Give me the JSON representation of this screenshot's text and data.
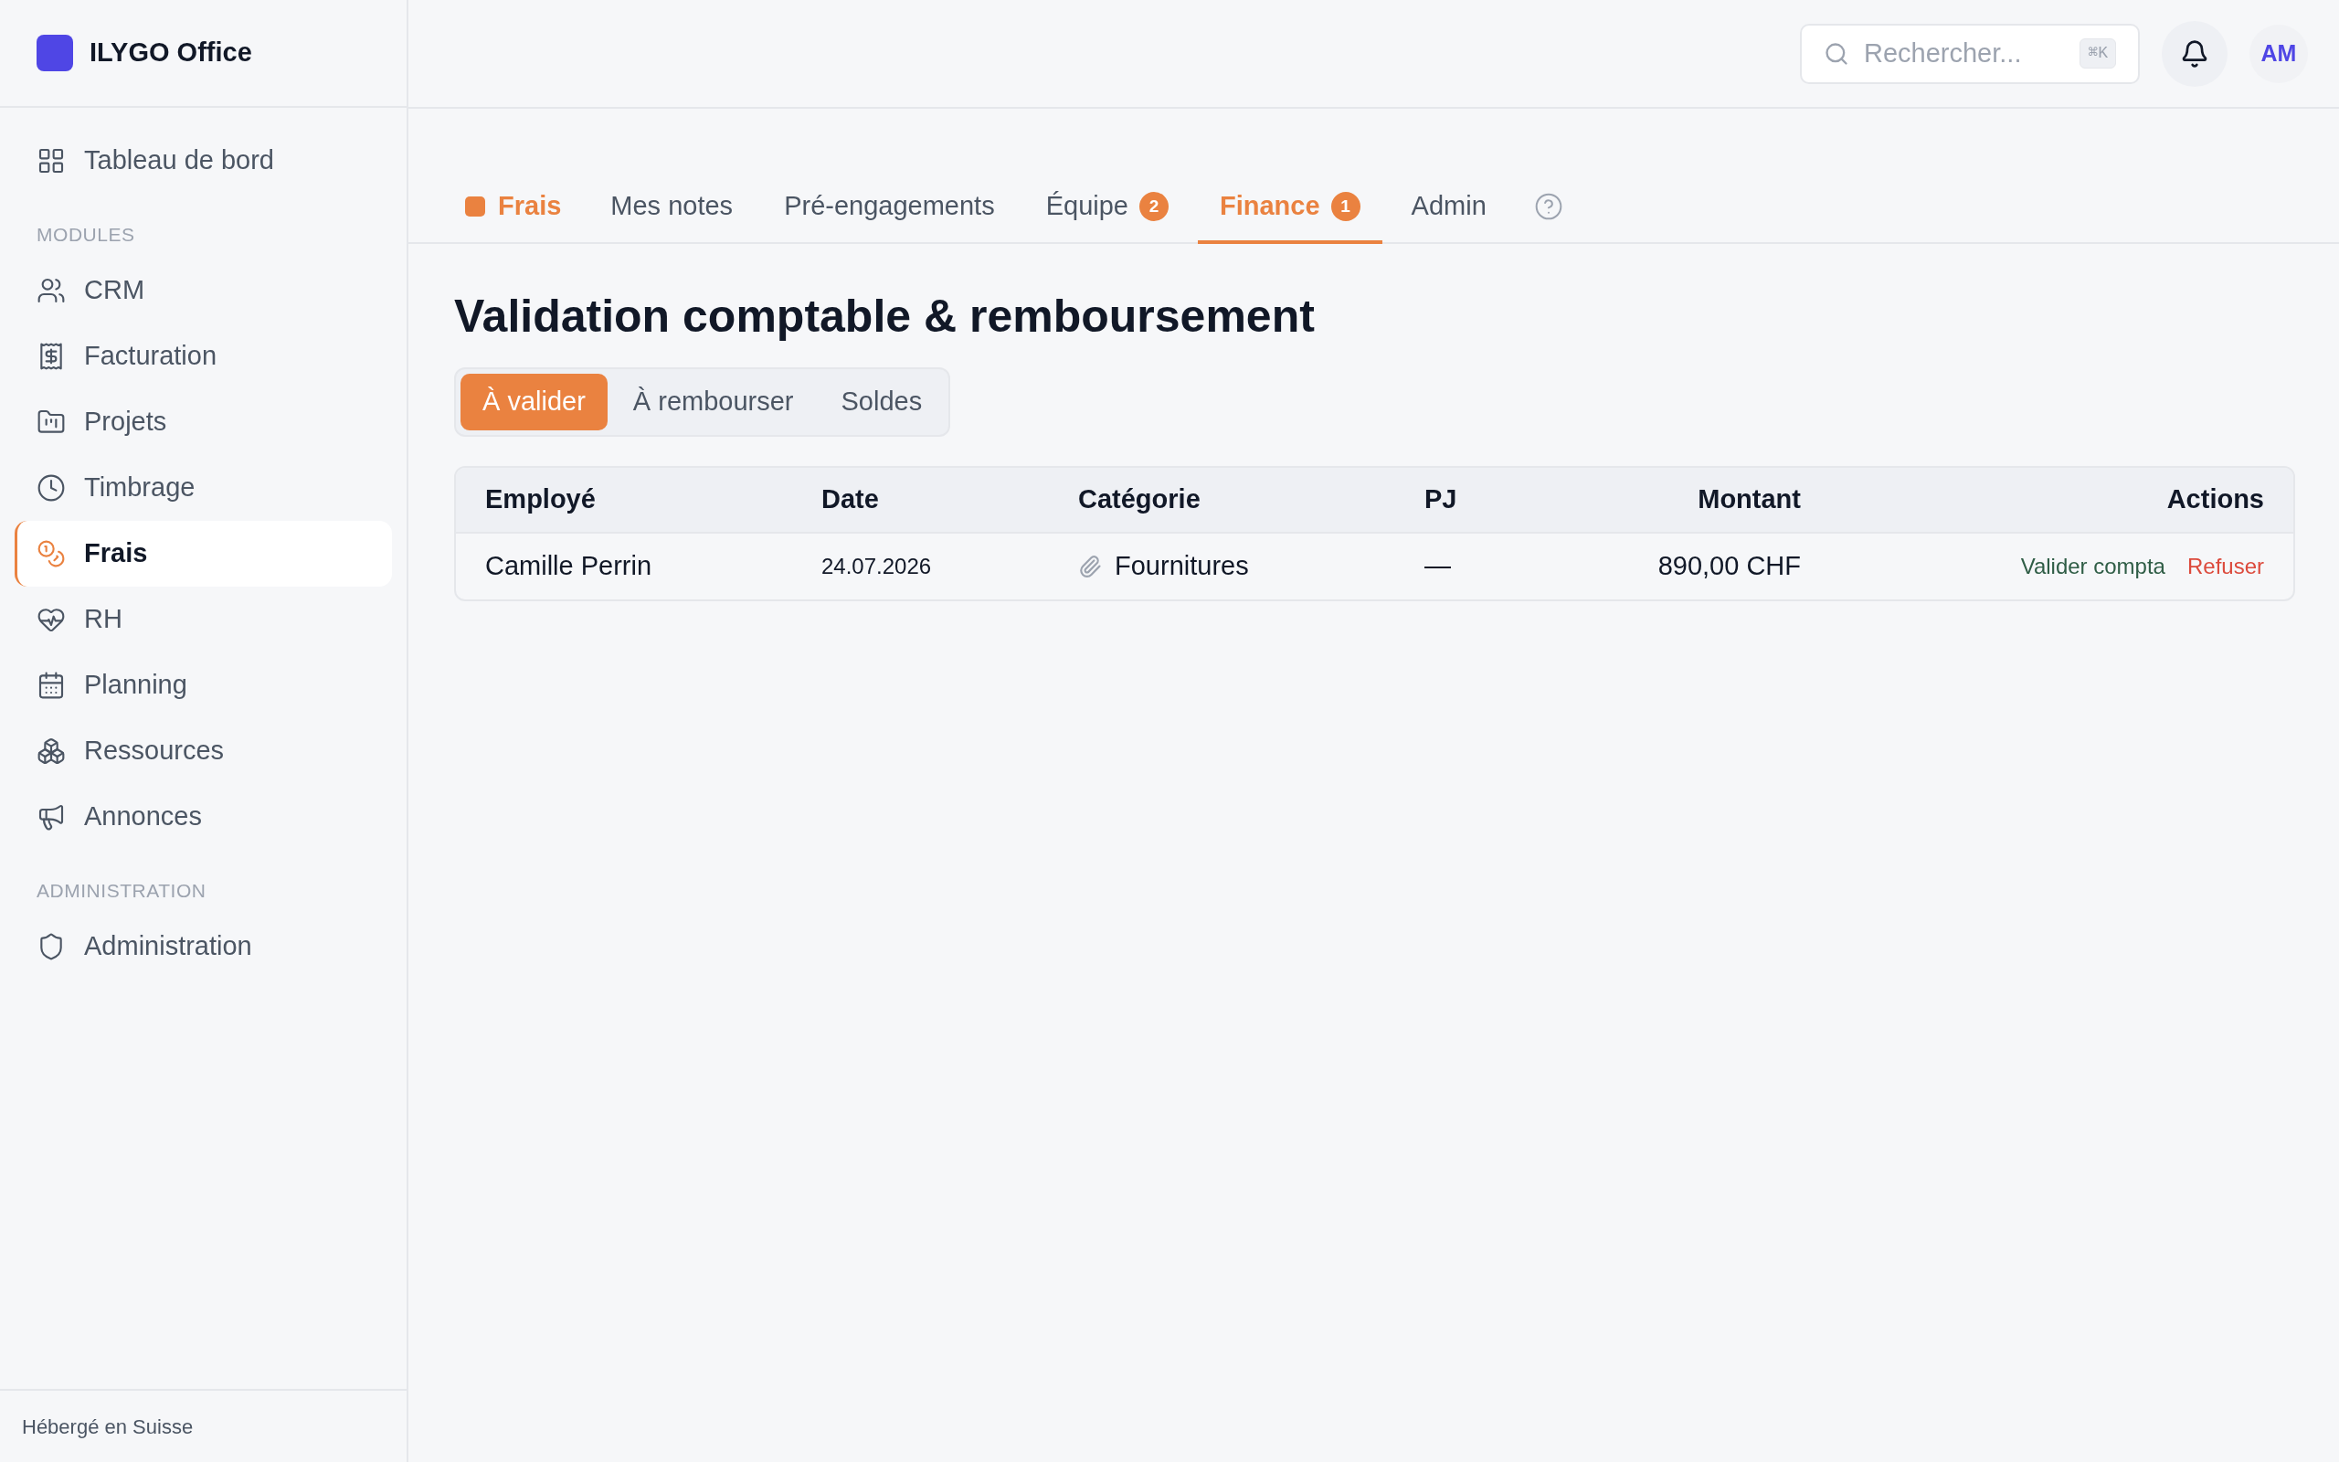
{
  "brand": {
    "name": "ILYGO Office"
  },
  "sidebar": {
    "top_item": {
      "label": "Tableau de bord",
      "selected": false
    },
    "sections": [
      {
        "heading": "MODULES",
        "items": [
          {
            "label": "CRM",
            "selected": false
          },
          {
            "label": "Facturation",
            "selected": false
          },
          {
            "label": "Projets",
            "selected": false
          },
          {
            "label": "Timbrage",
            "selected": false
          },
          {
            "label": "Frais",
            "selected": true
          },
          {
            "label": "RH",
            "selected": false
          },
          {
            "label": "Planning",
            "selected": false
          },
          {
            "label": "Ressources",
            "selected": false
          },
          {
            "label": "Annonces",
            "selected": false
          }
        ]
      },
      {
        "heading": "ADMINISTRATION",
        "items": [
          {
            "label": "Administration",
            "selected": false
          }
        ]
      }
    ],
    "footer": "Hébergé en Suisse"
  },
  "header": {
    "search": {
      "placeholder": "Rechercher...",
      "shortcut": "⌘K"
    },
    "avatar": "AM"
  },
  "module_label": "Frais",
  "tabs": [
    {
      "label": "Mes notes",
      "selected": false
    },
    {
      "label": "Pré-engagements",
      "selected": false
    },
    {
      "label": "Équipe",
      "badge": "2",
      "selected": false
    },
    {
      "label": "Finance",
      "badge": "1",
      "selected": true
    },
    {
      "label": "Admin",
      "selected": false
    }
  ],
  "title": "Validation comptable & remboursement",
  "segments": [
    {
      "label": "À valider",
      "selected": true
    },
    {
      "label": "À rembourser",
      "selected": false
    },
    {
      "label": "Soldes",
      "selected": false
    }
  ],
  "table": {
    "columns": [
      "Employé",
      "Date",
      "Catégorie",
      "PJ",
      "Montant",
      "Actions"
    ],
    "rows": [
      {
        "employee": "Camille Perrin",
        "date": "24.07.2026",
        "category": "Fournitures",
        "attachment": "—",
        "amount": "890,00 CHF",
        "actions": [
          "Valider compta",
          "Refuser"
        ]
      }
    ]
  }
}
